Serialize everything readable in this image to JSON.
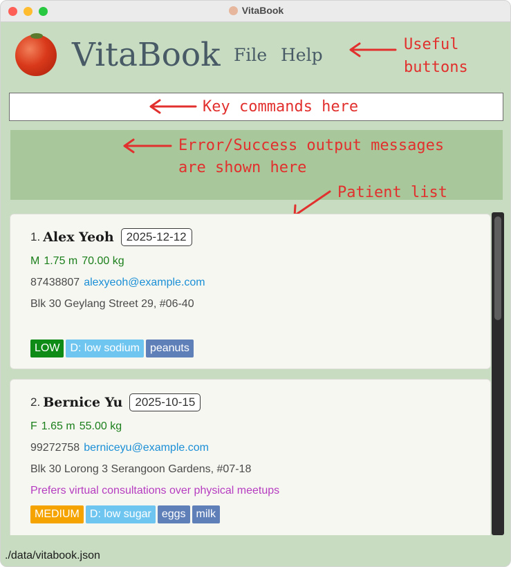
{
  "window": {
    "title": "VitaBook"
  },
  "header": {
    "app_name": "VitaBook",
    "menu": [
      {
        "label": "File"
      },
      {
        "label": "Help"
      }
    ]
  },
  "command_box": {
    "value": ""
  },
  "result_box": {
    "text": ""
  },
  "annotations": {
    "buttons_line1": "Useful",
    "buttons_line2": "buttons",
    "commands": "Key commands here",
    "output_line1": "Error/Success output messages",
    "output_line2": "are shown here",
    "patient_list": "Patient list"
  },
  "patients": [
    {
      "index": "1.",
      "name": "Alex Yeoh",
      "date": "2025-12-12",
      "sex": "M",
      "height": "1.75 m",
      "weight": "70.00 kg",
      "phone": "87438807",
      "email": "alexyeoh@example.com",
      "address": "Blk 30 Geylang Street 29, #06-40",
      "note": "",
      "priority": "LOW",
      "diet": "D: low sodium",
      "allergies": [
        "peanuts"
      ]
    },
    {
      "index": "2.",
      "name": "Bernice Yu",
      "date": "2025-10-15",
      "sex": "F",
      "height": "1.65 m",
      "weight": "55.00 kg",
      "phone": "99272758",
      "email": "berniceyu@example.com",
      "address": "Blk 30 Lorong 3 Serangoon Gardens, #07-18",
      "note": "Prefers virtual consultations over physical meetups",
      "priority": "MEDIUM",
      "diet": "D: low sugar",
      "allergies": [
        "eggs",
        "milk"
      ]
    }
  ],
  "status_bar": {
    "path": "./data/vitabook.json"
  },
  "colors": {
    "background": "#c7dcc0",
    "result_box": "#a8c79a",
    "annotation": "#e1302d",
    "tag_low": "#0e8a16",
    "tag_medium": "#f5a300",
    "tag_diet": "#6ec6f0",
    "tag_allergy": "#5f7fb8",
    "email": "#1a8fd6",
    "vitals": "#1a7f1a",
    "note": "#b53cc0"
  }
}
